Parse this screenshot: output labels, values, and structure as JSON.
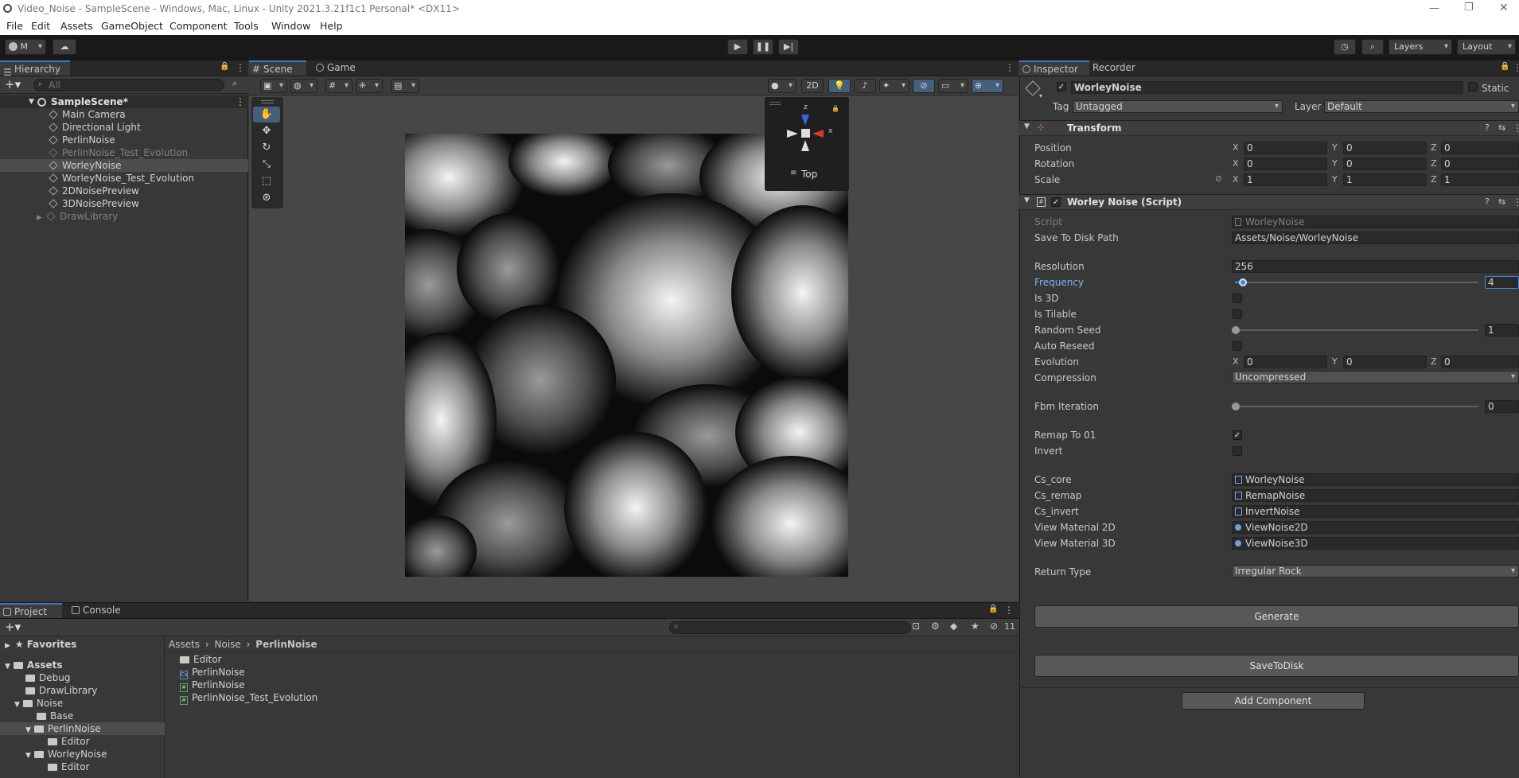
{
  "window": {
    "title": "Video_Noise - SampleScene - Windows, Mac, Linux - Unity 2021.3.21f1c1 Personal* <DX11>"
  },
  "menu": [
    "File",
    "Edit",
    "Assets",
    "GameObject",
    "Component",
    "Tools",
    "Window",
    "Help"
  ],
  "toolbar": {
    "account": "M",
    "layers": "Layers",
    "layout": "Layout"
  },
  "hierarchy": {
    "tab": "Hierarchy",
    "search_placeholder": "All",
    "scene": "SampleScene*",
    "items": [
      "Main Camera",
      "Directional Light",
      "PerlinNoise",
      "PerlinNoise_Test_Evolution",
      "WorleyNoise",
      "WorleyNoise_Test_Evolution",
      "2DNoisePreview",
      "3DNoisePreview",
      "DrawLibrary"
    ]
  },
  "scene_view": {
    "tabs": [
      "Scene",
      "Game"
    ],
    "mode_2d": "2D",
    "gizmo": {
      "label": "Top",
      "x": "x",
      "z": "z"
    }
  },
  "inspector": {
    "tabs": [
      "Inspector",
      "Recorder"
    ],
    "object_name": "WorleyNoise",
    "static_label": "Static",
    "tag_label": "Tag",
    "tag_value": "Untagged",
    "layer_label": "Layer",
    "layer_value": "Default",
    "transform": {
      "title": "Transform",
      "rows": [
        {
          "label": "Position",
          "x": "0",
          "y": "0",
          "z": "0"
        },
        {
          "label": "Rotation",
          "x": "0",
          "y": "0",
          "z": "0"
        },
        {
          "label": "Scale",
          "x": "1",
          "y": "1",
          "z": "1"
        }
      ]
    },
    "script": {
      "title": "Worley Noise (Script)",
      "script_label": "Script",
      "script_value": "WorleyNoise",
      "save_path_label": "Save To Disk Path",
      "save_path_value": "Assets/Noise/WorleyNoise",
      "resolution_label": "Resolution",
      "resolution_value": "256",
      "frequency_label": "Frequency",
      "frequency_value": "4",
      "frequency_fraction": 0.03,
      "is3d_label": "Is 3D",
      "istilable_label": "Is Tilable",
      "randomseed_label": "Random Seed",
      "randomseed_value": "1",
      "autoreseed_label": "Auto Reseed",
      "evolution_label": "Evolution",
      "evolution": {
        "x": "0",
        "y": "0",
        "z": "0"
      },
      "compression_label": "Compression",
      "compression_value": "Uncompressed",
      "fbm_label": "Fbm Iteration",
      "fbm_value": "0",
      "remap_label": "Remap To 01",
      "invert_label": "Invert",
      "cs_core_label": "Cs_core",
      "cs_core_value": "WorleyNoise",
      "cs_remap_label": "Cs_remap",
      "cs_remap_value": "RemapNoise",
      "cs_invert_label": "Cs_invert",
      "cs_invert_value": "InvertNoise",
      "vm2d_label": "View Material 2D",
      "vm2d_value": "ViewNoise2D",
      "vm3d_label": "View Material 3D",
      "vm3d_value": "ViewNoise3D",
      "return_label": "Return Type",
      "return_value": "Irregular Rock"
    },
    "generate_button": "Generate",
    "save_button": "SaveToDisk",
    "add_component_button": "Add Component"
  },
  "project": {
    "tabs": [
      "Project",
      "Console"
    ],
    "hidden_count": "11",
    "favorites": "Favorites",
    "tree": [
      "Assets",
      "Debug",
      "DrawLibrary",
      "Noise",
      "Base",
      "PerlinNoise",
      "Editor",
      "WorleyNoise",
      "Editor"
    ],
    "breadcrumb": [
      "Assets",
      "Noise",
      "PerlinNoise"
    ],
    "files": [
      "Editor",
      "PerlinNoise",
      "PerlinNoise",
      "PerlinNoise_Test_Evolution"
    ]
  },
  "colors": {
    "accent": "#3a79bb",
    "selection": "#4d4d4d"
  }
}
